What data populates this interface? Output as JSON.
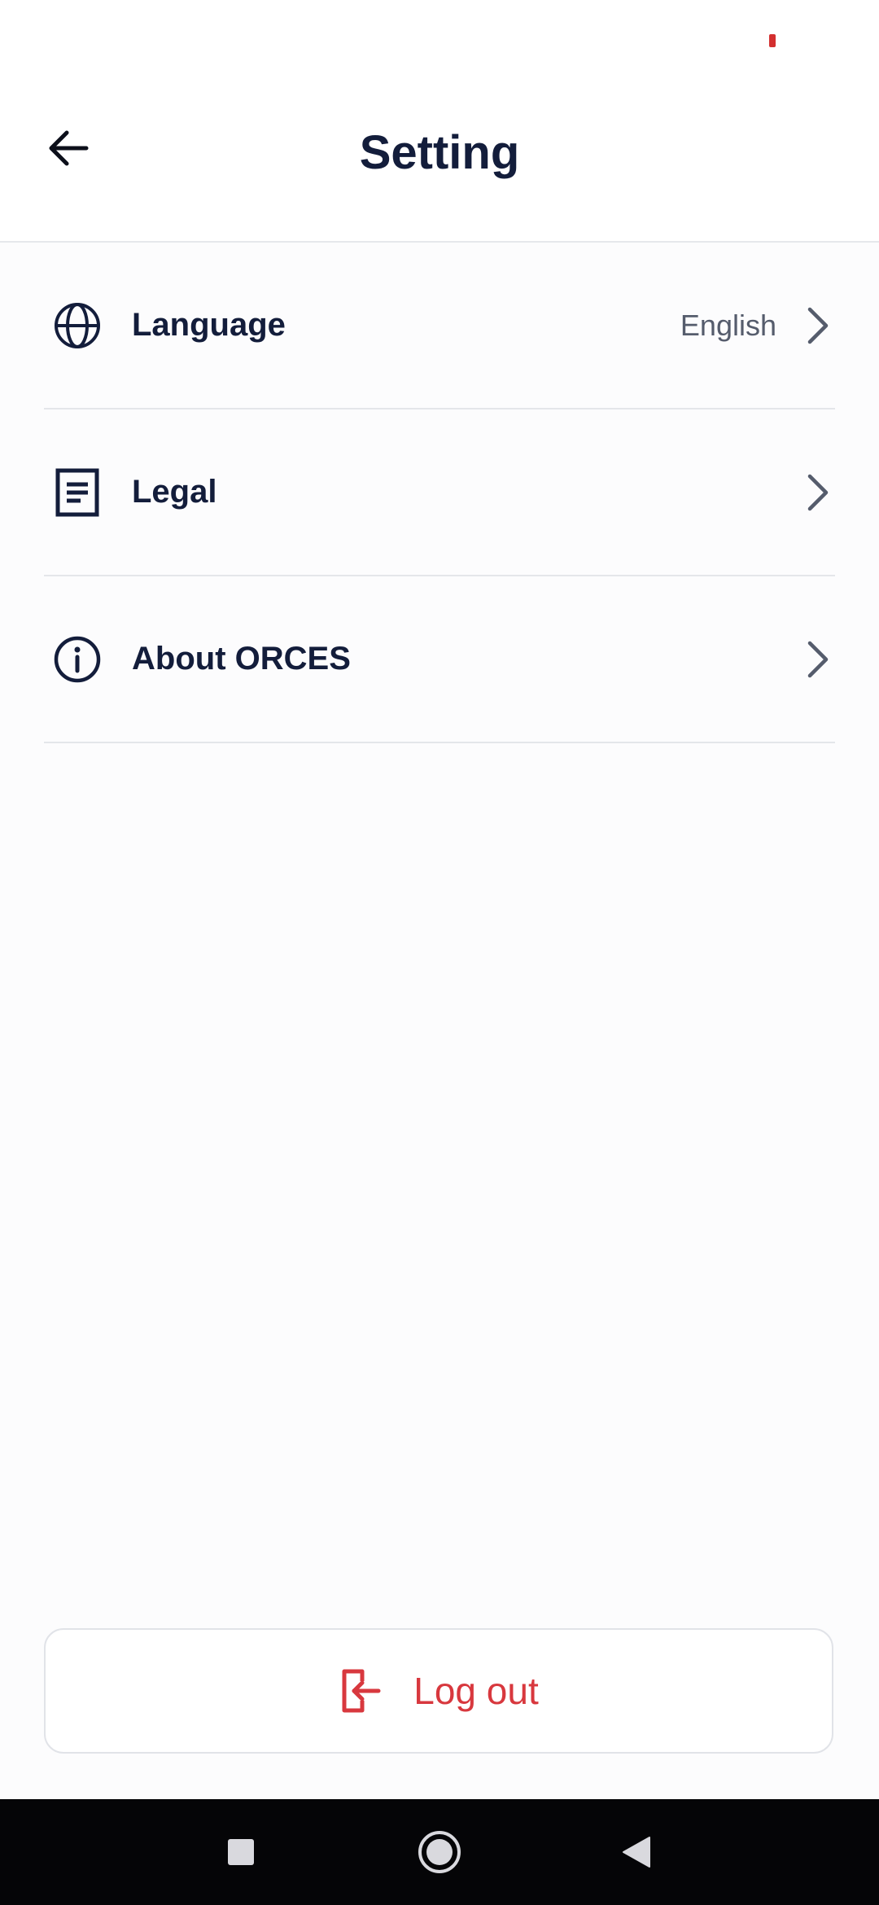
{
  "header": {
    "title": "Setting",
    "back_icon": "arrow-left-icon"
  },
  "settings": [
    {
      "label": "Language",
      "value": "English",
      "icon": "globe-icon"
    },
    {
      "label": "Legal",
      "value": "",
      "icon": "document-icon"
    },
    {
      "label": "About ORCES",
      "value": "",
      "icon": "info-icon"
    }
  ],
  "logout": {
    "label": "Log out",
    "icon": "logout-icon"
  },
  "system_nav": {
    "items": [
      "recents-button",
      "home-button",
      "back-nav-button"
    ]
  },
  "colors": {
    "text_primary": "#131d3b",
    "text_secondary": "#555c6c",
    "danger": "#d8383e",
    "divider": "#e4e6ea",
    "status_indicator": "#d32f2f",
    "nav_bar": "#050507"
  }
}
